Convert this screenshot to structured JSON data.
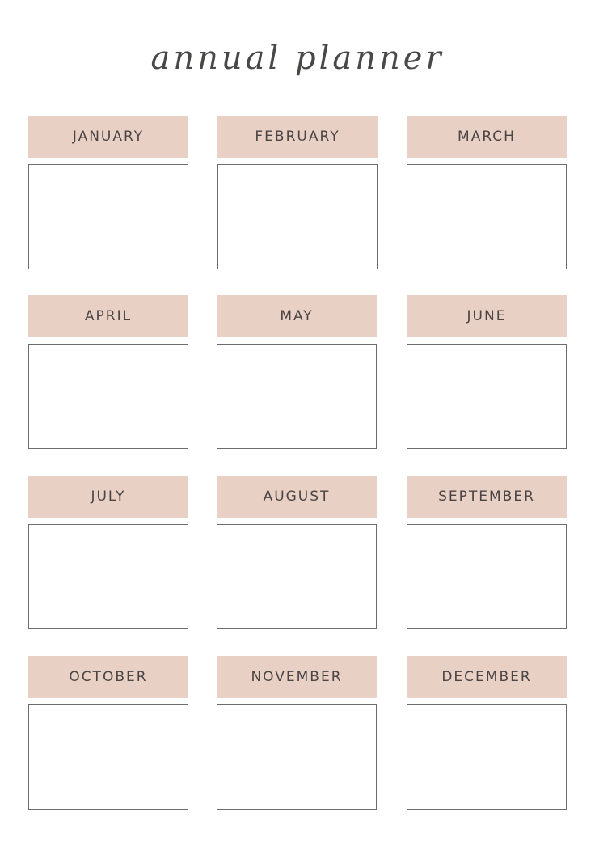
{
  "title": "annual planner",
  "colors": {
    "accent": "#e8d0c4",
    "border": "#6f6b6b",
    "text": "#4a4444"
  },
  "months": [
    {
      "label": "JANUARY"
    },
    {
      "label": "FEBRUARY"
    },
    {
      "label": "MARCH"
    },
    {
      "label": "APRIL"
    },
    {
      "label": "MAY"
    },
    {
      "label": "JUNE"
    },
    {
      "label": "JULY"
    },
    {
      "label": "AUGUST"
    },
    {
      "label": "SEPTEMBER"
    },
    {
      "label": "OCTOBER"
    },
    {
      "label": "NOVEMBER"
    },
    {
      "label": "DECEMBER"
    }
  ]
}
